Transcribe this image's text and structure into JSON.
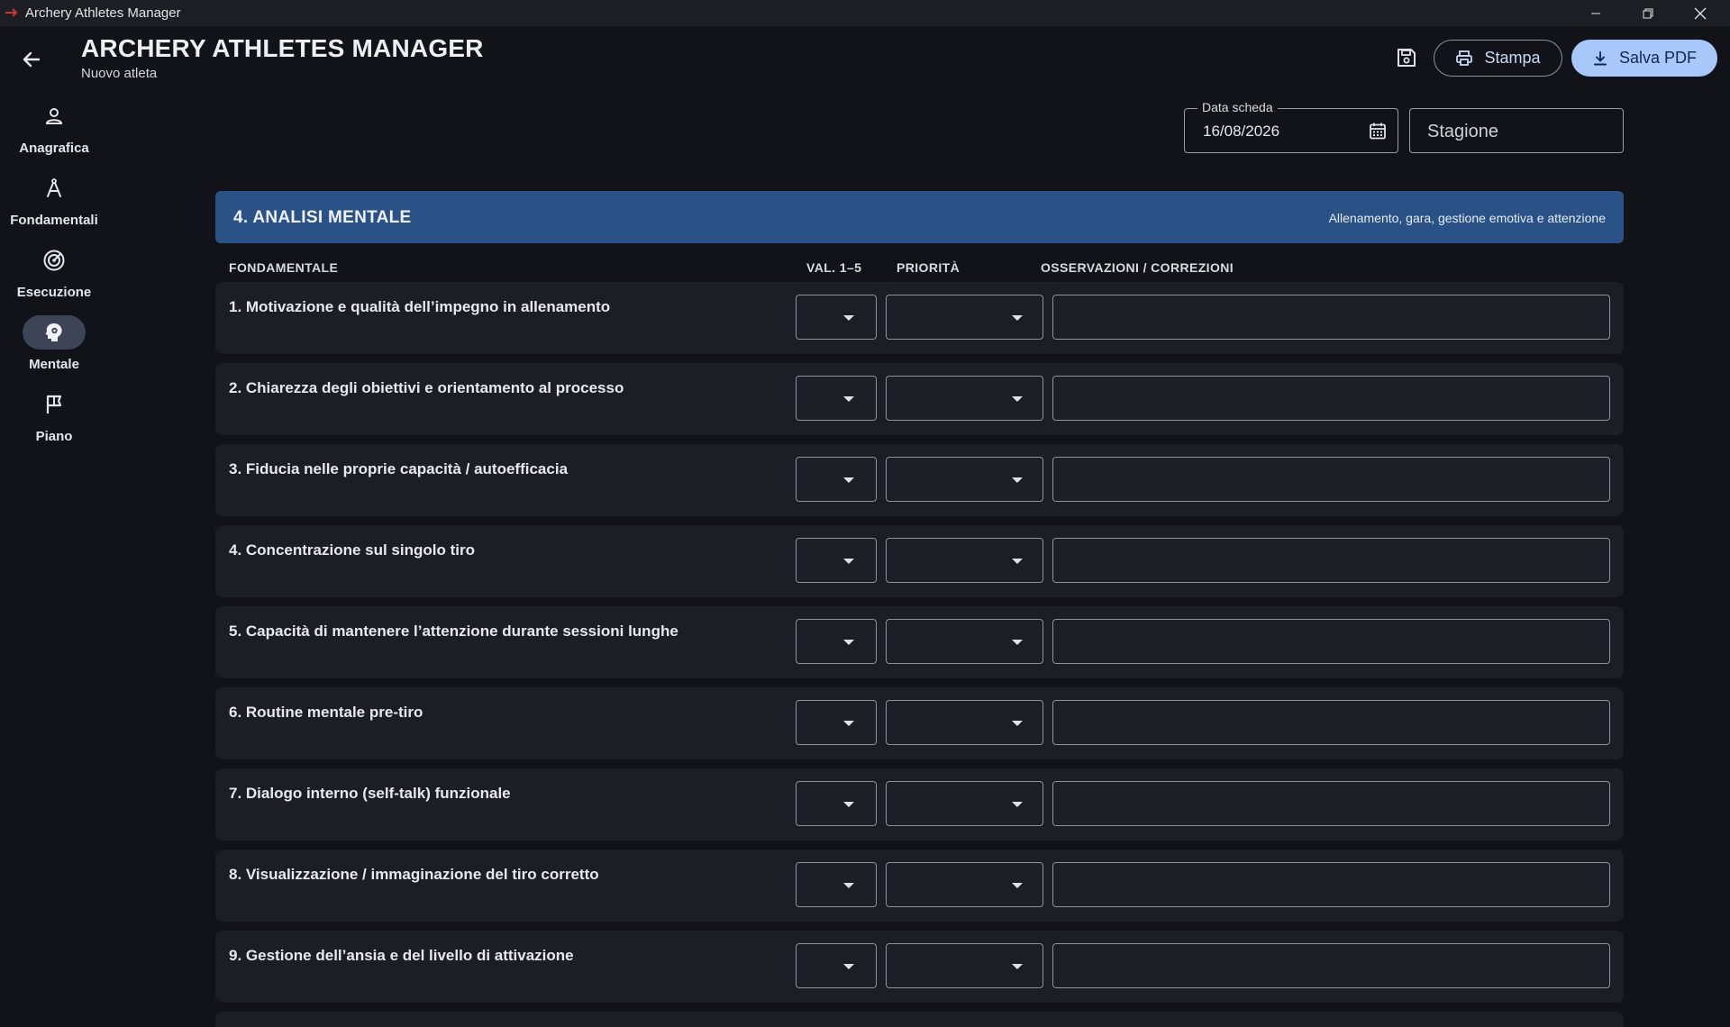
{
  "window": {
    "title": "Archery Athletes Manager"
  },
  "header": {
    "title": "ARCHERY ATHLETES MANAGER",
    "subtitle": "Nuovo atleta",
    "print_label": "Stampa",
    "pdf_label": "Salva PDF"
  },
  "sidebar": {
    "items": [
      {
        "label": "Anagrafica",
        "icon": "person-icon",
        "active": false
      },
      {
        "label": "Fondamentali",
        "icon": "compass-icon",
        "active": false
      },
      {
        "label": "Esecuzione",
        "icon": "target-icon",
        "active": false
      },
      {
        "label": "Mentale",
        "icon": "head-gear-icon",
        "active": true
      },
      {
        "label": "Piano",
        "icon": "flag-icon",
        "active": false
      }
    ]
  },
  "fields": {
    "date_label": "Data scheda",
    "date_value": "16/08/2026",
    "season_placeholder": "Stagione"
  },
  "section": {
    "title": "4. ANALISI MENTALE",
    "description": "Allenamento, gara, gestione emotiva e attenzione"
  },
  "columns": {
    "fondamentale": "FONDAMENTALE",
    "val": "VAL. 1–5",
    "priorita": "PRIORITÀ",
    "osservazioni": "OSSERVAZIONI / CORREZIONI"
  },
  "rows": [
    {
      "label": "1. Motivazione e qualità dell’impegno in allenamento",
      "val": "",
      "priority": "",
      "notes": ""
    },
    {
      "label": "2. Chiarezza degli obiettivi e orientamento al processo",
      "val": "",
      "priority": "",
      "notes": ""
    },
    {
      "label": "3. Fiducia nelle proprie capacità / autoefficacia",
      "val": "",
      "priority": "",
      "notes": ""
    },
    {
      "label": "4. Concentrazione sul singolo tiro",
      "val": "",
      "priority": "",
      "notes": ""
    },
    {
      "label": "5. Capacità di mantenere l’attenzione durante sessioni lunghe",
      "val": "",
      "priority": "",
      "notes": ""
    },
    {
      "label": "6. Routine mentale pre-tiro",
      "val": "",
      "priority": "",
      "notes": ""
    },
    {
      "label": "7. Dialogo interno (self-talk) funzionale",
      "val": "",
      "priority": "",
      "notes": ""
    },
    {
      "label": "8. Visualizzazione / immaginazione del tiro corretto",
      "val": "",
      "priority": "",
      "notes": ""
    },
    {
      "label": "9. Gestione dell’ansia e del livello di attivazione",
      "val": "",
      "priority": "",
      "notes": ""
    }
  ],
  "colors": {
    "background": "#111318",
    "section_header": "#2a5286",
    "row_bg": "#1b1e25",
    "primary_button": "#a8c7fa",
    "active_nav": "#3d4455"
  }
}
